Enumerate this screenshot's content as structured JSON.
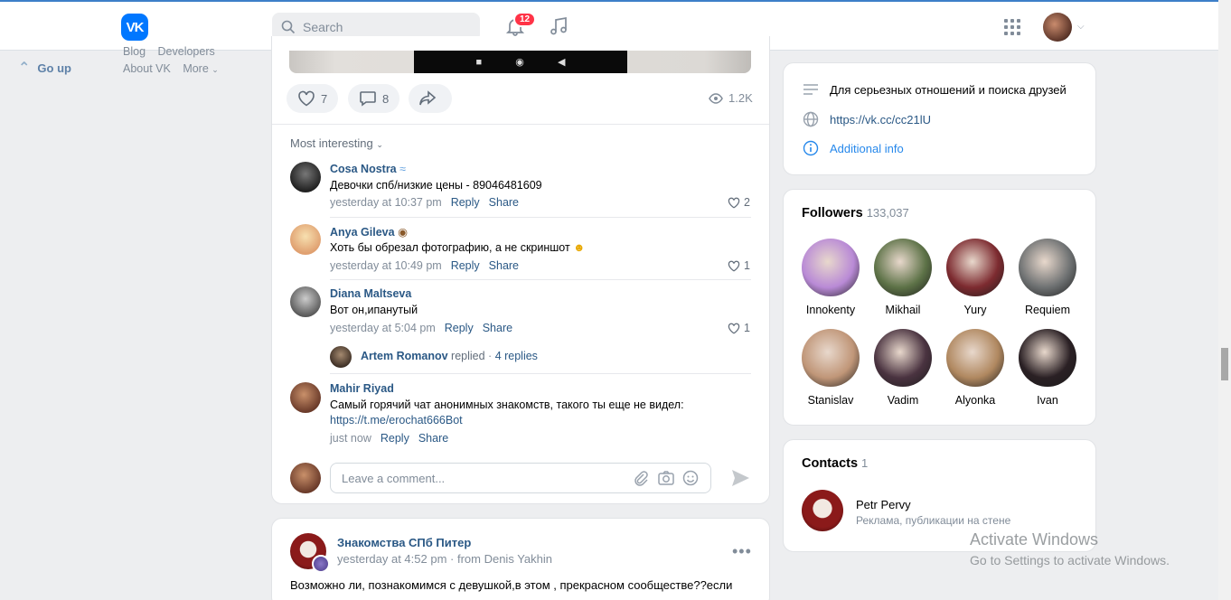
{
  "header": {
    "logo": "VK",
    "search_placeholder": "Search",
    "notifications_count": "12"
  },
  "left_nav": {
    "go_up": "Go up",
    "links": [
      "Blog",
      "Developers",
      "About VK",
      "More"
    ]
  },
  "post": {
    "likes": "7",
    "comments": "8",
    "views": "1.2K",
    "sort_label": "Most interesting",
    "comments_list": [
      {
        "author": "Cosa Nostra",
        "text": "Девочки спб/низкие цены - 89046481609",
        "time": "yesterday at 10:37 pm",
        "reply": "Reply",
        "share": "Share",
        "likes": "2"
      },
      {
        "author": "Anya Gileva",
        "text": "Хоть бы обрезал фотографию, а не скриншот",
        "time": "yesterday at 10:49 pm",
        "reply": "Reply",
        "share": "Share",
        "likes": "1"
      },
      {
        "author": "Diana Maltseva",
        "text": "Вот он,ипанутый",
        "time": "yesterday at 5:04 pm",
        "reply": "Reply",
        "share": "Share",
        "likes": "1"
      },
      {
        "author": "Mahir Riyad",
        "text": "Самый горячий чат анонимных знакомств, такого ты еще не видел:",
        "link": "https://t.me/erochat666Bot",
        "time": "just now",
        "reply": "Reply",
        "share": "Share"
      }
    ],
    "thread": {
      "author": "Artem Romanov",
      "action": "replied",
      "count": "4 replies"
    },
    "comment_placeholder": "Leave a comment..."
  },
  "post2": {
    "author": "Знакомства СПб Питер",
    "time": "yesterday at 4:52 pm",
    "from": "from Denis Yakhin",
    "text": "Возможно ли, познакомимся с девушкой,в этом , прекрасном сообществе??если"
  },
  "info": {
    "status": "Для серьезных отношений и поиска друзей",
    "url": "https://vk.cc/cc21lU",
    "more": "Additional info"
  },
  "followers": {
    "title": "Followers",
    "count": "133,037",
    "people": [
      {
        "name": "Innokenty",
        "color": "#b98ad6"
      },
      {
        "name": "Mikhail",
        "color": "#5d7247"
      },
      {
        "name": "Yury",
        "color": "#7d2b30"
      },
      {
        "name": "Requiem",
        "color": "#6e7172"
      },
      {
        "name": "Stanislav",
        "color": "#c09678"
      },
      {
        "name": "Vadim",
        "color": "#4a3340"
      },
      {
        "name": "Alyonka",
        "color": "#b08860"
      },
      {
        "name": "Ivan",
        "color": "#2a2024"
      }
    ]
  },
  "contacts": {
    "title": "Contacts",
    "count": "1",
    "name": "Petr Pervy",
    "role": "Реклама, публикации на стене"
  },
  "watermark": {
    "line1": "Activate Windows",
    "line2": "Go to Settings to activate Windows."
  },
  "colors": {
    "accent": "#0077ff",
    "link": "#2a5885",
    "badge": "#ff3347"
  }
}
